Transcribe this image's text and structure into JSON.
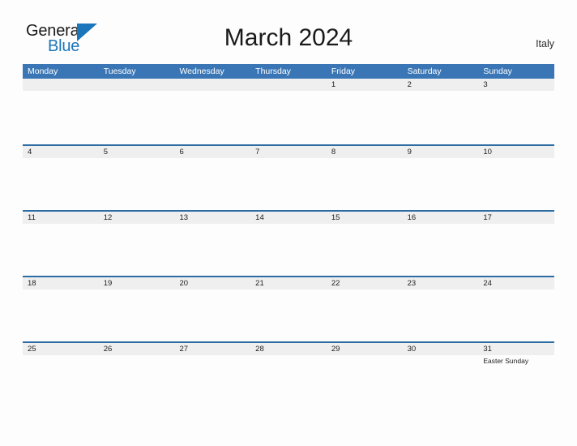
{
  "brand": {
    "name_part1": "General",
    "name_part2": "Blue",
    "flag_icon": "flag-triangle-icon",
    "accent_color": "#1b75bb"
  },
  "header": {
    "title": "March 2024",
    "country": "Italy"
  },
  "colors": {
    "header_blue": "#3a76b5",
    "row_divider_blue": "#2e6da4",
    "day_band_gray": "#efefef",
    "page_background": "#fdfdfd",
    "text": "#1d1d1d"
  },
  "calendar": {
    "month": "March",
    "year": "2024",
    "weekday_headers": [
      "Monday",
      "Tuesday",
      "Wednesday",
      "Thursday",
      "Friday",
      "Saturday",
      "Sunday"
    ],
    "weeks": [
      [
        {
          "day": "",
          "event": ""
        },
        {
          "day": "",
          "event": ""
        },
        {
          "day": "",
          "event": ""
        },
        {
          "day": "",
          "event": ""
        },
        {
          "day": "1",
          "event": ""
        },
        {
          "day": "2",
          "event": ""
        },
        {
          "day": "3",
          "event": ""
        }
      ],
      [
        {
          "day": "4",
          "event": ""
        },
        {
          "day": "5",
          "event": ""
        },
        {
          "day": "6",
          "event": ""
        },
        {
          "day": "7",
          "event": ""
        },
        {
          "day": "8",
          "event": ""
        },
        {
          "day": "9",
          "event": ""
        },
        {
          "day": "10",
          "event": ""
        }
      ],
      [
        {
          "day": "11",
          "event": ""
        },
        {
          "day": "12",
          "event": ""
        },
        {
          "day": "13",
          "event": ""
        },
        {
          "day": "14",
          "event": ""
        },
        {
          "day": "15",
          "event": ""
        },
        {
          "day": "16",
          "event": ""
        },
        {
          "day": "17",
          "event": ""
        }
      ],
      [
        {
          "day": "18",
          "event": ""
        },
        {
          "day": "19",
          "event": ""
        },
        {
          "day": "20",
          "event": ""
        },
        {
          "day": "21",
          "event": ""
        },
        {
          "day": "22",
          "event": ""
        },
        {
          "day": "23",
          "event": ""
        },
        {
          "day": "24",
          "event": ""
        }
      ],
      [
        {
          "day": "25",
          "event": ""
        },
        {
          "day": "26",
          "event": ""
        },
        {
          "day": "27",
          "event": ""
        },
        {
          "day": "28",
          "event": ""
        },
        {
          "day": "29",
          "event": ""
        },
        {
          "day": "30",
          "event": ""
        },
        {
          "day": "31",
          "event": "Easter Sunday"
        }
      ]
    ]
  }
}
